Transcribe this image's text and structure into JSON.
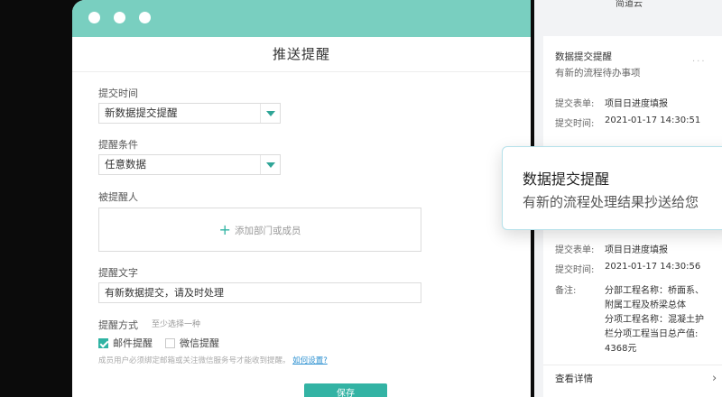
{
  "form": {
    "title": "推送提醒",
    "submit_time_label": "提交时间",
    "submit_time_value": "新数据提交提醒",
    "condition_label": "提醒条件",
    "condition_value": "任意数据",
    "recipients_label": "被提醒人",
    "add_member": "添加部门或成员",
    "text_label": "提醒文字",
    "text_value": "有新数据提交，请及时处理",
    "method_label": "提醒方式",
    "method_hint": "至少选择一种",
    "email_option": "邮件提醒",
    "email_checked": true,
    "wechat_option": "微信提醒",
    "wechat_checked": false,
    "notice": "成员用户必须绑定邮箱或关注微信服务号才能收到提醒。",
    "notice_link": "如何设置?",
    "save": "保存"
  },
  "panel": {
    "app_title": "简道云",
    "card": {
      "title": "数据提交提醒",
      "subtitle": "有新的流程待办事项",
      "more": "...",
      "form_key": "提交表单:",
      "form_val": "项目日进度填报",
      "time_key": "提交时间:",
      "time_val": "2021-01-17 14:30:51",
      "form_key2": "提交表单:",
      "form_val2": "项目日进度填报",
      "time_key2": "提交时间:",
      "time_val2": "2021-01-17 14:30:56",
      "note_key": "备注:",
      "note_lines": [
        "分部工程名称：桥面系、",
        "附属工程及桥梁总体",
        "分项工程名称：混凝土护",
        "栏分项工程当日总产值:",
        "4368元"
      ],
      "view_details": "查看详情"
    }
  },
  "toast": {
    "title": "数据提交提醒",
    "text": "有新的流程处理结果抄送给您"
  },
  "colors": {
    "accent": "#33b3a4",
    "titlebar": "#79cfc0",
    "link": "#2a8fd0"
  }
}
